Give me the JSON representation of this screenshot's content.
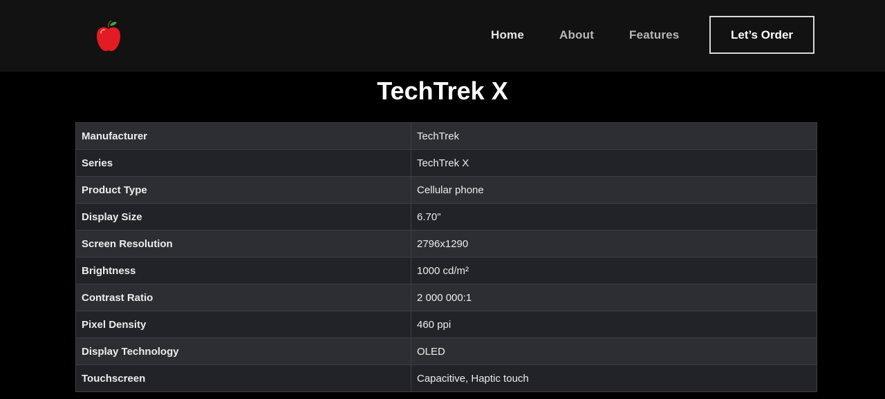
{
  "header": {
    "logo_icon": "apple-icon",
    "nav": [
      {
        "label": "Home"
      },
      {
        "label": "About"
      },
      {
        "label": "Features"
      }
    ],
    "cta_label": "Let’s Order"
  },
  "main": {
    "title": "TechTrek X",
    "specs": [
      {
        "label": "Manufacturer",
        "value": "TechTrek"
      },
      {
        "label": "Series",
        "value": "TechTrek X"
      },
      {
        "label": "Product Type",
        "value": "Cellular phone"
      },
      {
        "label": "Display Size",
        "value": "6.70\""
      },
      {
        "label": "Screen Resolution",
        "value": "2796x1290"
      },
      {
        "label": "Brightness",
        "value": "1000 cd/m²"
      },
      {
        "label": "Contrast Ratio",
        "value": "2 000 000:1"
      },
      {
        "label": "Pixel Density",
        "value": "460 ppi"
      },
      {
        "label": "Display Technology",
        "value": "OLED"
      },
      {
        "label": "Touchscreen",
        "value": "Capacitive, Haptic touch"
      }
    ]
  },
  "colors": {
    "background": "#000000",
    "navbar": "#121212",
    "row_odd": "#2c2e33",
    "row_even": "#212328",
    "logo_red": "#e31b23",
    "logo_leaf": "#3aa845"
  }
}
